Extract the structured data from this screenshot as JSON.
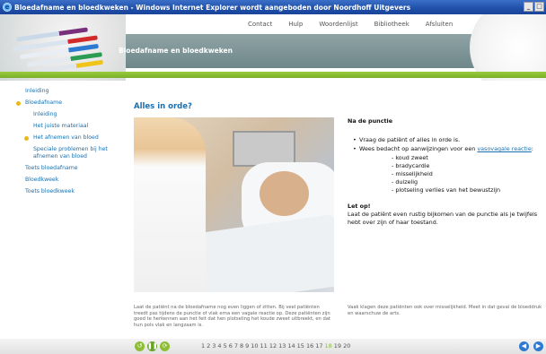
{
  "window": {
    "title": "Bloedafname en bloedkweken - Windows Internet Explorer wordt aangeboden door Noordhoff Uitgevers",
    "buttons": [
      "_",
      "□"
    ]
  },
  "topnav": [
    "Contact",
    "Hulp",
    "Woordenlijst",
    "Bibliotheek",
    "Afsluiten"
  ],
  "section_title": "Bloedafname en bloedkweken",
  "sidebar": {
    "items": [
      {
        "label": "Inleiding",
        "level": 0,
        "active": false
      },
      {
        "label": "Bloedafname",
        "level": 0,
        "active": true
      },
      {
        "label": "Inleiding",
        "level": 1,
        "active": false
      },
      {
        "label": "Het juiste materiaal",
        "level": 1,
        "active": false
      },
      {
        "label": "Het afnemen van bloed",
        "level": 1,
        "active": true
      },
      {
        "label": "Speciale problemen bij het afnemen van bloed",
        "level": 1,
        "active": false
      },
      {
        "label": "Toets bloedafname",
        "level": 0,
        "active": false
      },
      {
        "label": "Bloedkweek",
        "level": 0,
        "active": false
      },
      {
        "label": "Toets bloedkweek",
        "level": 0,
        "active": false
      }
    ]
  },
  "main": {
    "title": "Alles in orde?",
    "heading": "Na de punctie",
    "bullet1": "Vraag de patiënt of alles in orde is.",
    "bullet2_prefix": "Wees bedacht op aanwijzingen voor een ",
    "bullet2_link": "vasovagale reactie",
    "bullet2_suffix": ":",
    "symptoms": [
      "- koud zweet",
      "- bradycardie",
      "- misselijkheid",
      "- duizelig",
      "- plotseling verlies van het bewustzijn"
    ],
    "letop_label": "Let op!",
    "letop_text": "Laat de patiënt even rustig bijkomen van de punctie als je twijfels hebt over zijn of haar toestand.",
    "caption_left": "Laat de patiënt na de bloedafname nog even liggen of zitten. Bij veel patiënten treedt pas tijdens de punctie of vlak erna een vagale reactie op. Deze patiënten zijn goed te herkennen aan het feit dat hen plotseling het koude zweet uitbreekt, en dat hun pols vlak en langzaam is.",
    "caption_right": "Vaak klagen deze patiënten ook over misselijkheid. Meet in dat geval de bloeddruk en waarschuw de arts."
  },
  "pager": {
    "pages": [
      "1",
      "2",
      "3",
      "4",
      "5",
      "6",
      "7",
      "8",
      "9",
      "10",
      "11",
      "12",
      "13",
      "14",
      "15",
      "16",
      "17",
      "18",
      "19",
      "20"
    ],
    "current": "18"
  },
  "colors": {
    "accent_blue": "#1a6fae",
    "accent_green": "#8cbd35",
    "bullet_yellow": "#e8b81c"
  }
}
